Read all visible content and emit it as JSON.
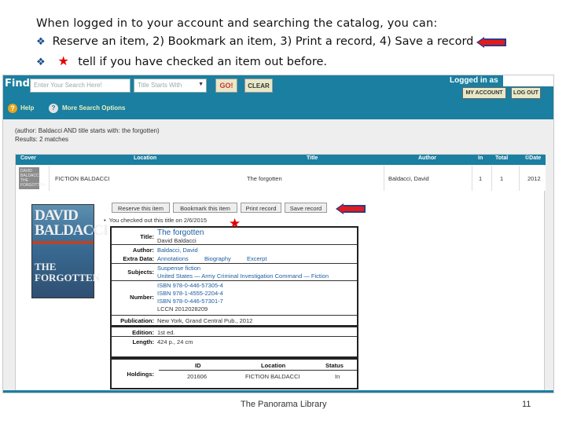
{
  "slide": {
    "intro": "When logged in to your account and searching the catalog, you can:",
    "bullet1": "Reserve an item, 2) Bookmark an item, 3) Print a record, 4) Save a record",
    "bullet2": "tell if you have checked an item out before.",
    "bullet_glyph": "❖",
    "star_glyph": "★",
    "footer": "The Panorama Library",
    "page_number": "11",
    "accent_red": "#e41b1b"
  },
  "opac": {
    "find_label": "Find:",
    "search_placeholder": "Enter Your Search Here!",
    "search_type": "Title Starts With",
    "search_type_caret": "▼",
    "go_label": "GO!",
    "clear_label": "CLEAR",
    "logged_in": "Logged in as",
    "my_account": "MY ACCOUNT",
    "log_out": "LOG OUT",
    "help_icon": "?",
    "help": "Help",
    "more_icon": "?",
    "more_options": "More Search Options",
    "bar_color": "#1a7fa0"
  },
  "results": {
    "query": "(author: Baldacci AND title starts with: the forgotten)",
    "count_label": "Results: 2 matches",
    "headers": [
      "Cover",
      "Location",
      "Title",
      "Author",
      "In",
      "Total",
      "©Date"
    ],
    "row": {
      "cover_text": "DAVID BALDACCI THE FORGOTTEN",
      "location": "FICTION BALDACCI",
      "title": "The forgotten",
      "author": "Baldacci, David",
      "in": "1",
      "total": "1",
      "date": "2012"
    },
    "actions": [
      "Reserve this item",
      "Bookmark this item",
      "Print record",
      "Save record"
    ],
    "checked_out_bullet": "•",
    "checked_out_note": "You checked out this title on 2/6/2015"
  },
  "book_cover": {
    "author_line1": "DAVID",
    "author_line2": "BALDACCI",
    "title_line1": "THE",
    "title_line2": "FORGOTTEN"
  },
  "record": {
    "title_label": "Title:",
    "title": "The forgotten",
    "statement": "David Baldacci",
    "author_label": "Author:",
    "author": "Baldacci, David",
    "extra_label": "Extra Data:",
    "extra": [
      "Annotations",
      "Biography",
      "Excerpt"
    ],
    "subjects_label": "Subjects:",
    "subjects": [
      "Suspense fiction",
      "United States — Army Criminal Investigation Command — Fiction"
    ],
    "number_label": "Number:",
    "numbers": [
      "ISBN   978-0-446-57305-4",
      "ISBN   978-1-4555-2204-4",
      "ISBN   978-0-446-57301-7",
      "LCCN   2012028209"
    ],
    "publication_label": "Publication:",
    "publication": "New York, Grand Central Pub., 2012",
    "edition_label": "Edition:",
    "edition": "1st ed.",
    "length_label": "Length:",
    "length": "424 p., 24 cm",
    "holdings_label": "Holdings:",
    "holdings_headers": [
      "ID",
      "Location",
      "Status"
    ],
    "holdings_row": [
      "201606",
      "FICTION BALDACCI",
      "In"
    ]
  }
}
